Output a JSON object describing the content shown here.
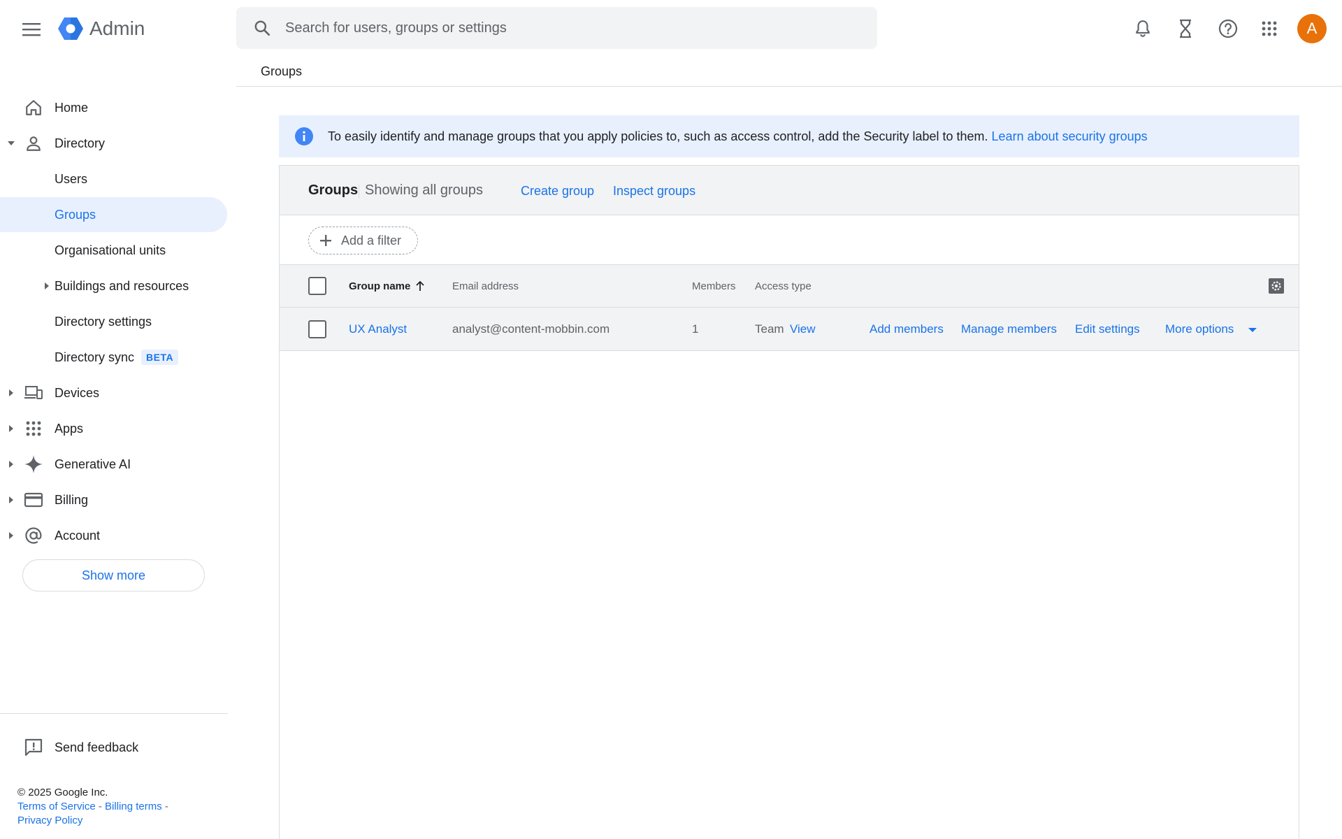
{
  "app": {
    "name": "Admin"
  },
  "search": {
    "placeholder": "Search for users, groups or settings"
  },
  "topbar": {
    "avatar_letter": "A"
  },
  "breadcrumb": "Groups",
  "sidebar": {
    "items": [
      {
        "label": "Home"
      },
      {
        "label": "Directory"
      },
      {
        "label": "Users"
      },
      {
        "label": "Groups"
      },
      {
        "label": "Organisational units"
      },
      {
        "label": "Buildings and resources"
      },
      {
        "label": "Directory settings"
      },
      {
        "label": "Directory sync",
        "badge": "BETA"
      },
      {
        "label": "Devices"
      },
      {
        "label": "Apps"
      },
      {
        "label": "Generative AI"
      },
      {
        "label": "Billing"
      },
      {
        "label": "Account"
      }
    ],
    "show_more": "Show more",
    "feedback": "Send feedback",
    "footer": {
      "copyright": "© 2025 Google Inc.",
      "terms": "Terms of Service",
      "billing_terms": "Billing terms",
      "privacy": "Privacy Policy",
      "separator": "-"
    }
  },
  "banner": {
    "text": "To easily identify and manage groups that you apply policies to, such as access control, add the Security label to them.",
    "link": "Learn about security groups"
  },
  "panel": {
    "title": "Groups",
    "subtitle": "Showing all groups",
    "create_group": "Create group",
    "inspect_groups": "Inspect groups",
    "add_filter": "Add a filter",
    "columns": {
      "group_name": "Group name",
      "email": "Email address",
      "members": "Members",
      "access_type": "Access type"
    },
    "rows": [
      {
        "name": "UX Analyst",
        "email": "analyst@content-mobbin.com",
        "members": "1",
        "access_type": "Team",
        "view": "View",
        "add_members": "Add members",
        "manage_members": "Manage members",
        "edit_settings": "Edit settings",
        "more_options": "More options"
      }
    ]
  },
  "colors": {
    "accent": "#1a73e8",
    "active_bg": "#e8f0fe",
    "avatar": "#e8710a",
    "header_bg": "#f1f3f4"
  }
}
